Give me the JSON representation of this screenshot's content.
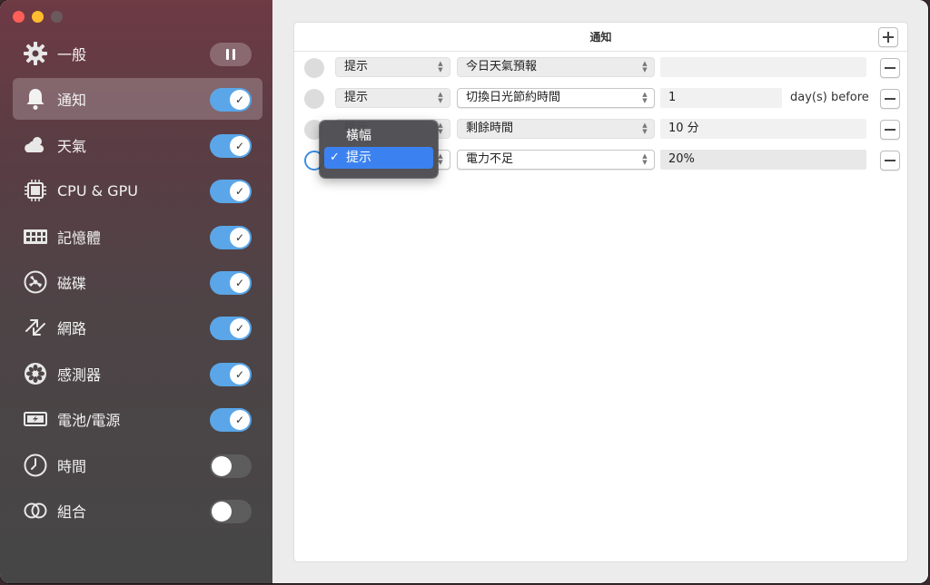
{
  "sidebar": {
    "items": [
      {
        "label": "一般",
        "icon": "gear-icon",
        "control": "pause",
        "active": false
      },
      {
        "label": "通知",
        "icon": "bell-icon",
        "control": "on",
        "active": true
      },
      {
        "label": "天氣",
        "icon": "cloud-sun-icon",
        "control": "on",
        "active": false
      },
      {
        "label": "CPU & GPU",
        "icon": "chip-icon",
        "control": "on",
        "active": false
      },
      {
        "label": "記憶體",
        "icon": "memory-icon",
        "control": "on",
        "active": false
      },
      {
        "label": "磁碟",
        "icon": "disk-icon",
        "control": "on",
        "active": false
      },
      {
        "label": "網路",
        "icon": "network-arrows-icon",
        "control": "on",
        "active": false
      },
      {
        "label": "感測器",
        "icon": "fan-icon",
        "control": "on",
        "active": false
      },
      {
        "label": "電池/電源",
        "icon": "battery-icon",
        "control": "on",
        "active": false
      },
      {
        "label": "時間",
        "icon": "clock-icon",
        "control": "off",
        "active": false
      },
      {
        "label": "組合",
        "icon": "combine-rings-icon",
        "control": "off",
        "active": false
      }
    ]
  },
  "panel": {
    "title": "通知",
    "rows": [
      {
        "type": "提示",
        "trigger": "今日天氣預報",
        "value": "",
        "suffix": ""
      },
      {
        "type": "提示",
        "trigger": "切換日光節約時間",
        "value": "1",
        "suffix": "day(s) before"
      },
      {
        "type": "提示",
        "trigger": "剩餘時間",
        "value": "10 分",
        "suffix": ""
      },
      {
        "type": "提示",
        "trigger": "電力不足",
        "value": "20%",
        "suffix": ""
      }
    ]
  },
  "dropdown": {
    "options": [
      "橫幅",
      "提示"
    ],
    "selected": "提示",
    "check": "✓"
  },
  "colors": {
    "accent": "#3b82f0",
    "toggle_on": "#5aa6e8"
  }
}
